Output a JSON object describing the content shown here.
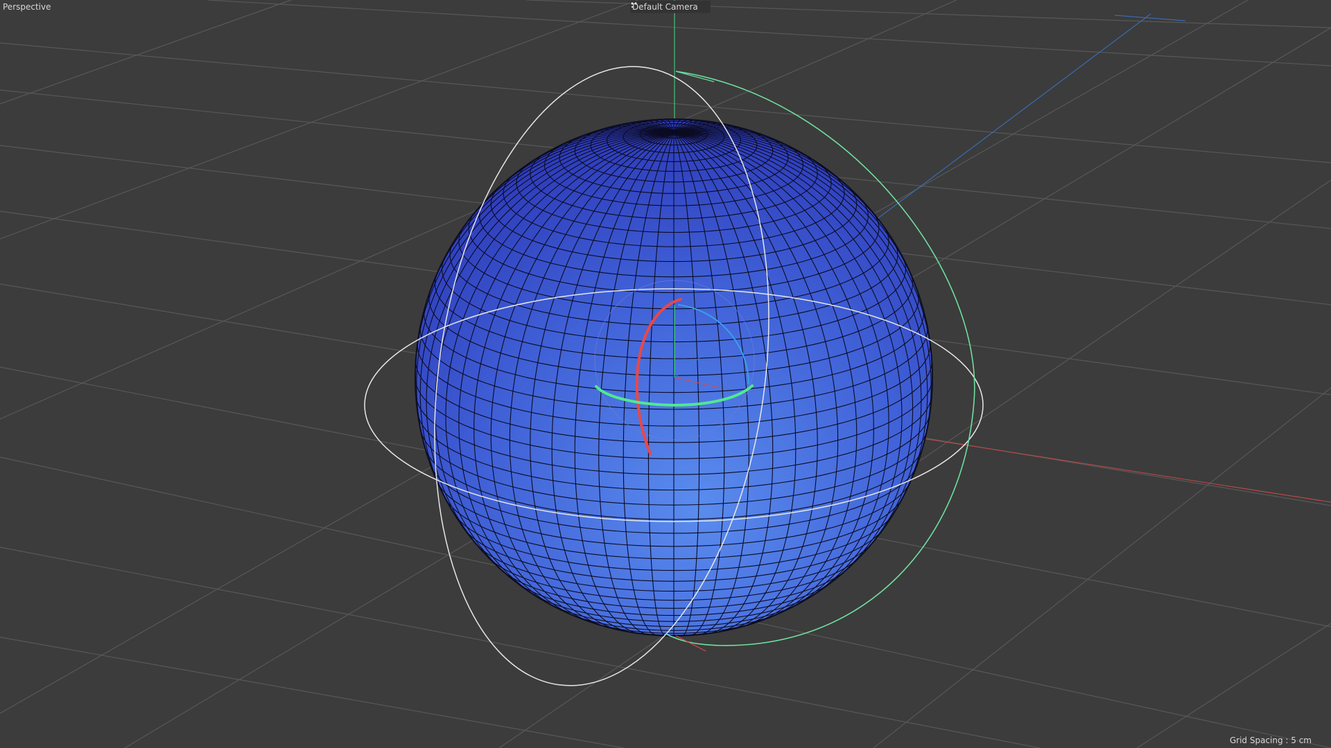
{
  "viewport": {
    "view_name": "Perspective",
    "camera_name": "Default Camera",
    "camera_icon": "camera-dots-icon",
    "grid_spacing_label": "Grid Spacing : 5 cm"
  },
  "colors": {
    "background": "#3c3c3c",
    "grid_line": "#5a5a5a",
    "sphere_light": "#5a86ea",
    "sphere_dark": "#2a36b8",
    "wire": "#0b0b1a",
    "axis_x": "#e04848",
    "axis_y": "#46e08a",
    "axis_z": "#3a7fd8",
    "rotation_ring": "#e8e8e8"
  },
  "scene": {
    "object": "sphere",
    "active_tool": "rotate"
  }
}
